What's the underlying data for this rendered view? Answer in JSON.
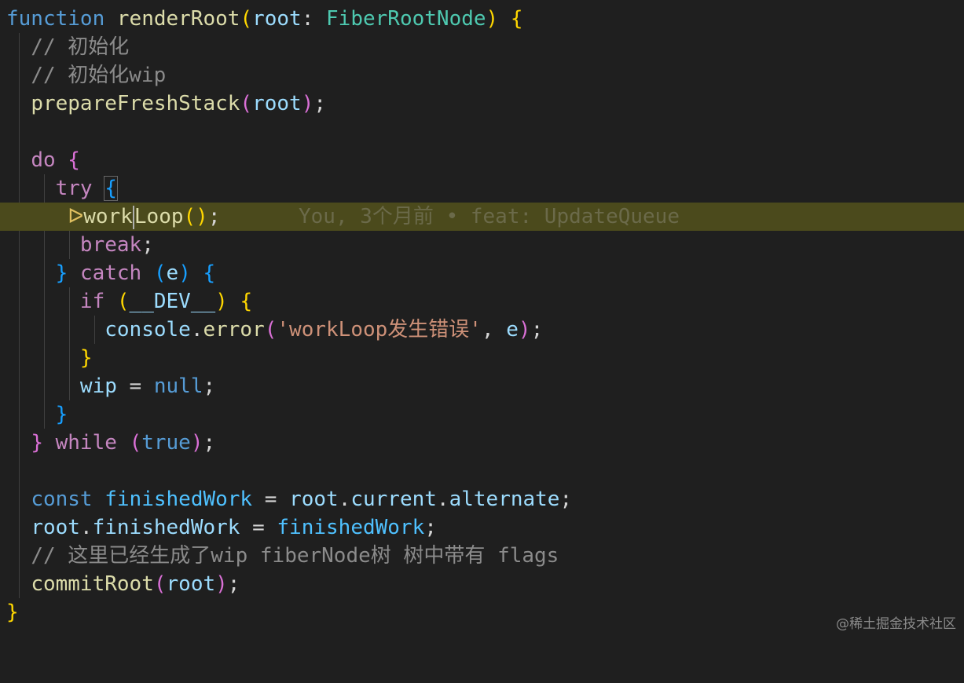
{
  "colors": {
    "background": "#1f1f1f",
    "highlight": "#4b4a1c",
    "keyword": "#569cd6",
    "control": "#c586c0",
    "function": "#dcdcaa",
    "variable": "#9cdcfe",
    "type": "#4ec9b0",
    "comment": "#8b8b8b",
    "string": "#ce9178"
  },
  "code": {
    "l1": {
      "kw": "function",
      "fn": "renderRoot",
      "p1": "(",
      "param": "root",
      "colon": ": ",
      "type": "FiberRootNode",
      "p2": ")",
      "brace": "{"
    },
    "l2": {
      "comment": "// 初始化"
    },
    "l3": {
      "comment": "// 初始化wip"
    },
    "l4": {
      "fn": "prepareFreshStack",
      "p1": "(",
      "arg": "root",
      "p2": ")",
      "semi": ";"
    },
    "l6": {
      "kw": "do",
      "brace": "{"
    },
    "l7": {
      "kw": "try",
      "brace": "{"
    },
    "l8": {
      "marker": "ᐅ",
      "fn_a": "work",
      "fn_b": "Loop",
      "parens": "()",
      "semi": ";"
    },
    "l9": {
      "kw": "break",
      "semi": ";"
    },
    "l10": {
      "close": "}",
      "kw": "catch",
      "p1": "(",
      "arg": "e",
      "p2": ")",
      "brace": "{"
    },
    "l11": {
      "kw": "if",
      "p1": "(",
      "cond": "__DEV__",
      "p2": ")",
      "brace": "{"
    },
    "l12": {
      "obj": "console",
      "dot": ".",
      "fn": "error",
      "p1": "(",
      "str": "'workLoop发生错误'",
      "comma": ", ",
      "arg": "e",
      "p2": ")",
      "semi": ";"
    },
    "l13": {
      "close": "}"
    },
    "l14": {
      "var": "wip",
      "eq": " = ",
      "val": "null",
      "semi": ";"
    },
    "l15": {
      "close": "}"
    },
    "l16": {
      "close": "}",
      "kw": "while",
      "p1": "(",
      "val": "true",
      "p2": ")",
      "semi": ";"
    },
    "l18": {
      "kw": "const",
      "name": "finishedWork",
      "eq": " = ",
      "obj": "root",
      "d1": ".",
      "p1": "current",
      "d2": ".",
      "p2": "alternate",
      "semi": ";"
    },
    "l19": {
      "obj": "root",
      "dot": ".",
      "prop": "finishedWork",
      "eq": " = ",
      "val": "finishedWork",
      "semi": ";"
    },
    "l20": {
      "comment": "// 这里已经生成了wip fiberNode树 树中带有 flags"
    },
    "l21": {
      "fn": "commitRoot",
      "p1": "(",
      "arg": "root",
      "p2": ")",
      "semi": ";"
    },
    "l22": {
      "close": "}"
    }
  },
  "blame": "You, 3个月前 • feat: UpdateQueue",
  "watermark": "@稀土掘金技术社区"
}
